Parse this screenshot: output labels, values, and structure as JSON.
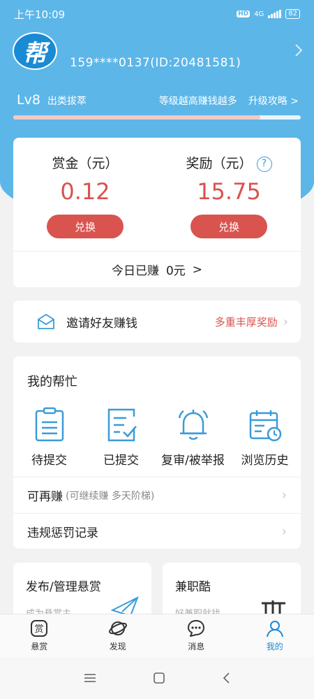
{
  "status_bar": {
    "time": "上午10:09",
    "hd": "HD",
    "network": "4G",
    "battery": "82"
  },
  "profile": {
    "logo_text": "帮",
    "user_id": "159****0137(ID:20481581)"
  },
  "level": {
    "lv": "Lv8",
    "title": "出类拔萃",
    "tip": "等级越高赚钱越多",
    "guide": "升级攻略 >",
    "progress": 0.86
  },
  "money": {
    "bounty_label": "赏金（元）",
    "bounty_value": "0.12",
    "reward_label": "奖励（元）",
    "reward_value": "15.75",
    "exchange_label": "兑换",
    "today_label": "今日已赚",
    "today_value": "0元",
    "today_arrow": ">"
  },
  "invite": {
    "text": "邀请好友赚钱",
    "reward": "多重丰厚奖励"
  },
  "my_help": {
    "title": "我的帮忙",
    "items": [
      {
        "label": "待提交",
        "icon": "clipboard-icon"
      },
      {
        "label": "已提交",
        "icon": "submitted-doc-icon"
      },
      {
        "label": "复审/被举报",
        "icon": "bell-icon"
      },
      {
        "label": "浏览历史",
        "icon": "calendar-clock-icon"
      }
    ],
    "reearn_label": "可再赚",
    "reearn_sub": "(可继续赚 多天阶梯)",
    "penalty_label": "违规惩罚记录"
  },
  "bottom_cards": [
    {
      "title": "发布/管理悬赏",
      "sub": "成为悬赏主"
    },
    {
      "title": "兼职酷",
      "sub": "好兼职就找"
    }
  ],
  "tabbar": [
    {
      "label": "悬赏",
      "icon": "bounty-icon"
    },
    {
      "label": "发现",
      "icon": "planet-icon"
    },
    {
      "label": "消息",
      "icon": "chat-icon"
    },
    {
      "label": "我的",
      "icon": "person-icon",
      "active": true
    }
  ],
  "colors": {
    "header": "#5cb6e8",
    "accent_red": "#d9534f",
    "accent_blue": "#1a8ad4"
  }
}
